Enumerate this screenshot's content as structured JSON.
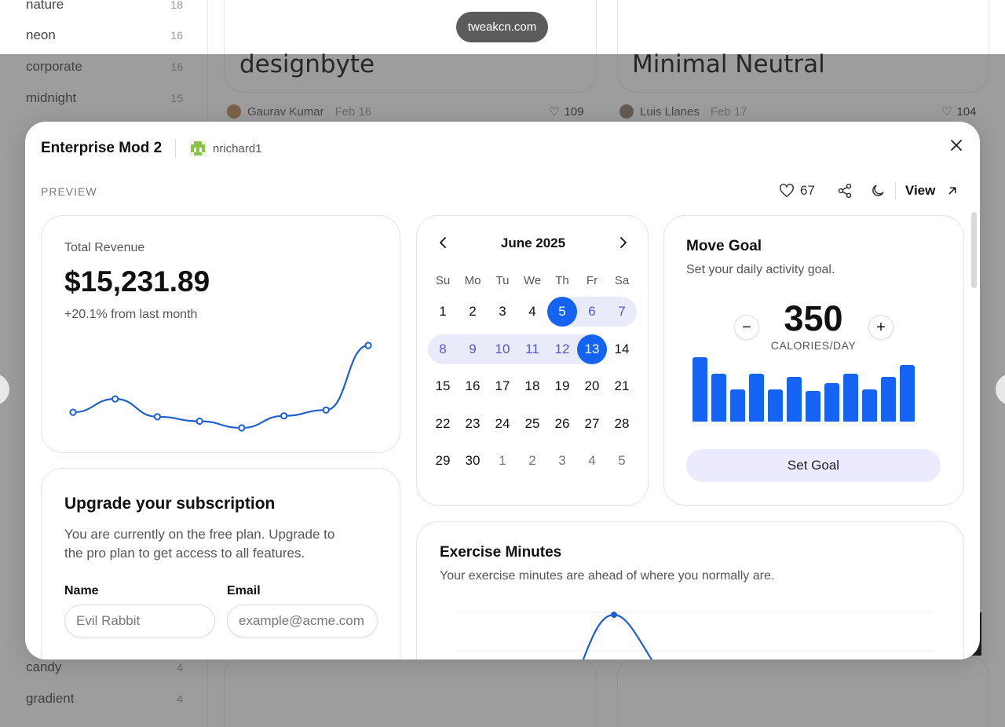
{
  "background": {
    "tags": [
      {
        "name": "nature",
        "count": "18"
      },
      {
        "name": "neon",
        "count": "16"
      },
      {
        "name": "corporate",
        "count": "16"
      },
      {
        "name": "midnight",
        "count": "15"
      },
      {
        "name": "candy",
        "count": "4"
      },
      {
        "name": "gradient",
        "count": "4"
      }
    ],
    "toast": "tweakcn.com",
    "cards": [
      {
        "title": "designbyte",
        "author": "Gaurav Kumar",
        "date": "Feb 16",
        "likes": "109"
      },
      {
        "title": "Minimal Neutral",
        "author": "Luis Llanes",
        "date": "Feb 17",
        "likes": "104"
      }
    ]
  },
  "modal": {
    "title": "Enterprise Mod 2",
    "username": "nrichard1",
    "preview_label": "PREVIEW",
    "likes": "67",
    "view_label": "View",
    "revenue": {
      "label": "Total Revenue",
      "value": "$15,231.89",
      "change": "+20.1% from last month",
      "trend": [
        0.5,
        0.8,
        0.4,
        0.3,
        0.15,
        0.42,
        0.55,
        2.0
      ],
      "color": "#1f5fcf"
    },
    "upgrade": {
      "title": "Upgrade your subscription",
      "description": "You are currently on the free plan. Upgrade to the pro plan to get access to all features.",
      "name_label": "Name",
      "name_placeholder": "Evil Rabbit",
      "email_label": "Email",
      "email_placeholder": "example@acme.com"
    },
    "calendar": {
      "month": "June 2025",
      "weekdays": [
        "Su",
        "Mo",
        "Tu",
        "We",
        "Th",
        "Fr",
        "Sa"
      ],
      "weeks": [
        [
          {
            "d": "1"
          },
          {
            "d": "2"
          },
          {
            "d": "3"
          },
          {
            "d": "4"
          },
          {
            "d": "5",
            "state": "sel"
          },
          {
            "d": "6",
            "state": "inrange"
          },
          {
            "d": "7",
            "state": "inrange"
          }
        ],
        [
          {
            "d": "8",
            "state": "inrange"
          },
          {
            "d": "9",
            "state": "inrange"
          },
          {
            "d": "10",
            "state": "inrange"
          },
          {
            "d": "11",
            "state": "inrange"
          },
          {
            "d": "12",
            "state": "inrange"
          },
          {
            "d": "13",
            "state": "sel"
          },
          {
            "d": "14"
          }
        ],
        [
          {
            "d": "15"
          },
          {
            "d": "16"
          },
          {
            "d": "17"
          },
          {
            "d": "18"
          },
          {
            "d": "19"
          },
          {
            "d": "20"
          },
          {
            "d": "21"
          }
        ],
        [
          {
            "d": "22"
          },
          {
            "d": "23"
          },
          {
            "d": "24"
          },
          {
            "d": "25"
          },
          {
            "d": "26"
          },
          {
            "d": "27"
          },
          {
            "d": "28"
          }
        ],
        [
          {
            "d": "29"
          },
          {
            "d": "30"
          },
          {
            "d": "1",
            "state": "out"
          },
          {
            "d": "2",
            "state": "out"
          },
          {
            "d": "3",
            "state": "out"
          },
          {
            "d": "4",
            "state": "out"
          },
          {
            "d": "5",
            "state": "out"
          }
        ]
      ],
      "accent": "#1463f3"
    },
    "move_goal": {
      "title": "Move Goal",
      "subtitle": "Set your daily activity goal.",
      "value": "350",
      "unit": "CALORIES/DAY",
      "bars": [
        400,
        300,
        200,
        300,
        200,
        278,
        189,
        239,
        300,
        200,
        278,
        350
      ],
      "button_label": "Set Goal",
      "color": "#1463f3"
    },
    "exercise": {
      "title": "Exercise Minutes",
      "subtitle": "Your exercise minutes are ahead of where you normally are."
    }
  }
}
